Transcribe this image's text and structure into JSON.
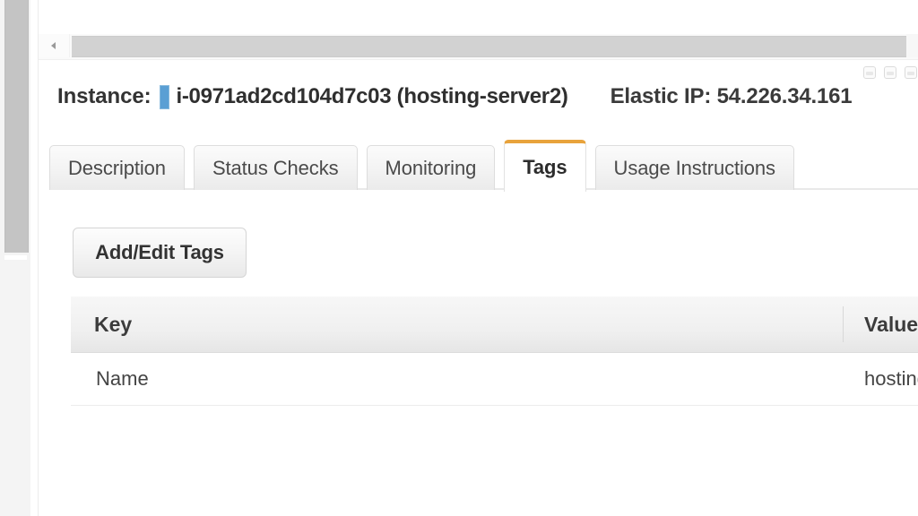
{
  "window": {
    "horizontal_scrollbar": {
      "left_arrow_icon": "triangle-left-icon"
    },
    "mini_icons": [
      "window-icon-1",
      "window-icon-2",
      "window-icon-3"
    ]
  },
  "instance_header": {
    "label": "Instance:",
    "cursor_marker": "text-cursor-marker",
    "instance_id": "i-0971ad2cd104d7c03 (hosting-server2)",
    "elastic_ip": "Elastic IP: 54.226.34.161"
  },
  "tabs": [
    {
      "label": "Description",
      "active": false
    },
    {
      "label": "Status Checks",
      "active": false
    },
    {
      "label": "Monitoring",
      "active": false
    },
    {
      "label": "Tags",
      "active": true
    },
    {
      "label": "Usage Instructions",
      "active": false
    }
  ],
  "tags_panel": {
    "add_edit_button": "Add/Edit Tags",
    "table": {
      "columns": [
        "Key",
        "Value"
      ],
      "rows": [
        {
          "key": "Name",
          "value": "hosting-se"
        }
      ]
    }
  },
  "colors": {
    "active_tab_accent": "#e8a33c",
    "cursor_marker": "#5a9fd4",
    "scrollbar_thumb": "#c4c4c4",
    "header_gradient_top": "#f7f7f7",
    "header_gradient_bottom": "#e6e6e6"
  }
}
